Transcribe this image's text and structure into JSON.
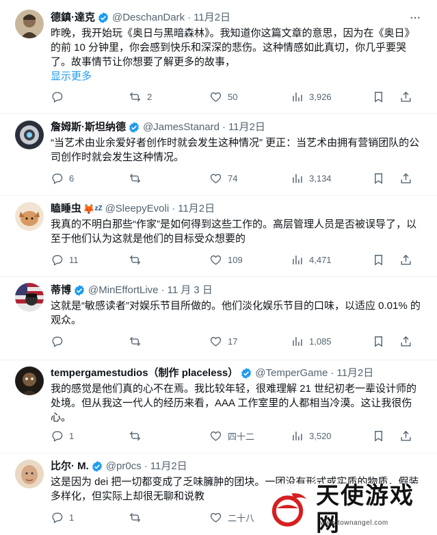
{
  "colors": {
    "accent": "#1d9bf0",
    "text": "#0f1419",
    "secondary": "#536471",
    "divider": "#eff3f4"
  },
  "tweets": [
    {
      "name": "德鎮·達克",
      "handle": "@DeschanDark",
      "date": "11月2日",
      "verified": true,
      "text": "昨晚，我开始玩《奥日与黑暗森林》。我知道你这篇文章的意思，因为在《奥日》的前 10 分钟里，你会感到快乐和深深的悲伤。这种情感如此真切，你几乎要哭了。故事情节让你想要了解更多的故事，",
      "show_more": "显示更多",
      "replies": "",
      "retweets": "2",
      "likes": "50",
      "views": "3,926"
    },
    {
      "name": "詹姆斯·斯坦纳德",
      "handle": "@JamesStanard",
      "date": "11月2日",
      "verified": true,
      "text": "“当艺术由业余爱好者创作时就会发生这种情况” 更正：当艺术由拥有营销团队的公司创作时就会发生这种情况。",
      "replies": "6",
      "retweets": "",
      "likes": "74",
      "views": "3,134"
    },
    {
      "name": "瞌睡虫",
      "name_emoji": "🦊",
      "name_zz": "zZ",
      "handle": "@SleepyEvoli",
      "date": "11月2日",
      "verified": false,
      "text": "我真的不明白那些“作家”是如何得到这些工作的。高层管理人员是否被误导了，以至于他们认为这就是他们的目标受众想要的",
      "replies": "11",
      "retweets": "",
      "likes": "109",
      "views": "4,471"
    },
    {
      "name": "蒂博",
      "handle": "@MinEffortLive",
      "date": "11 月 3 日",
      "verified": true,
      "text": "这就是“敏感读者”对娱乐节目所做的。他们淡化娱乐节目的口味，以适应 0.01% 的观众。",
      "replies": "",
      "retweets": "",
      "likes": "17",
      "views": "1,085"
    },
    {
      "name": "tempergamestudios（制作 placeless）",
      "handle": "@TemperGame",
      "date": "11月2日",
      "verified": true,
      "text": "我的感觉是他们真的心不在焉。我比较年轻，很难理解 21 世纪初老一辈设计师的处境。但从我这一代人的经历来看，AAA 工作室里的人都相当冷漠。这让我很伤心。",
      "replies": "1",
      "retweets": "",
      "likes": "四十二",
      "views": "3,520"
    },
    {
      "name": "比尔· M.",
      "handle": "@pr0cs",
      "date": "11月2日",
      "verified": true,
      "text": "这是因为 dei 把一切都变成了乏味臃肿的团块。一团没有形式或实质的物质，假装多样化，但实际上却很无聊和说教",
      "replies": "1",
      "retweets": "",
      "likes": "二十八",
      "views": ""
    }
  ],
  "watermark": {
    "text": "天使游戏网",
    "url": "www.townangel.com"
  }
}
